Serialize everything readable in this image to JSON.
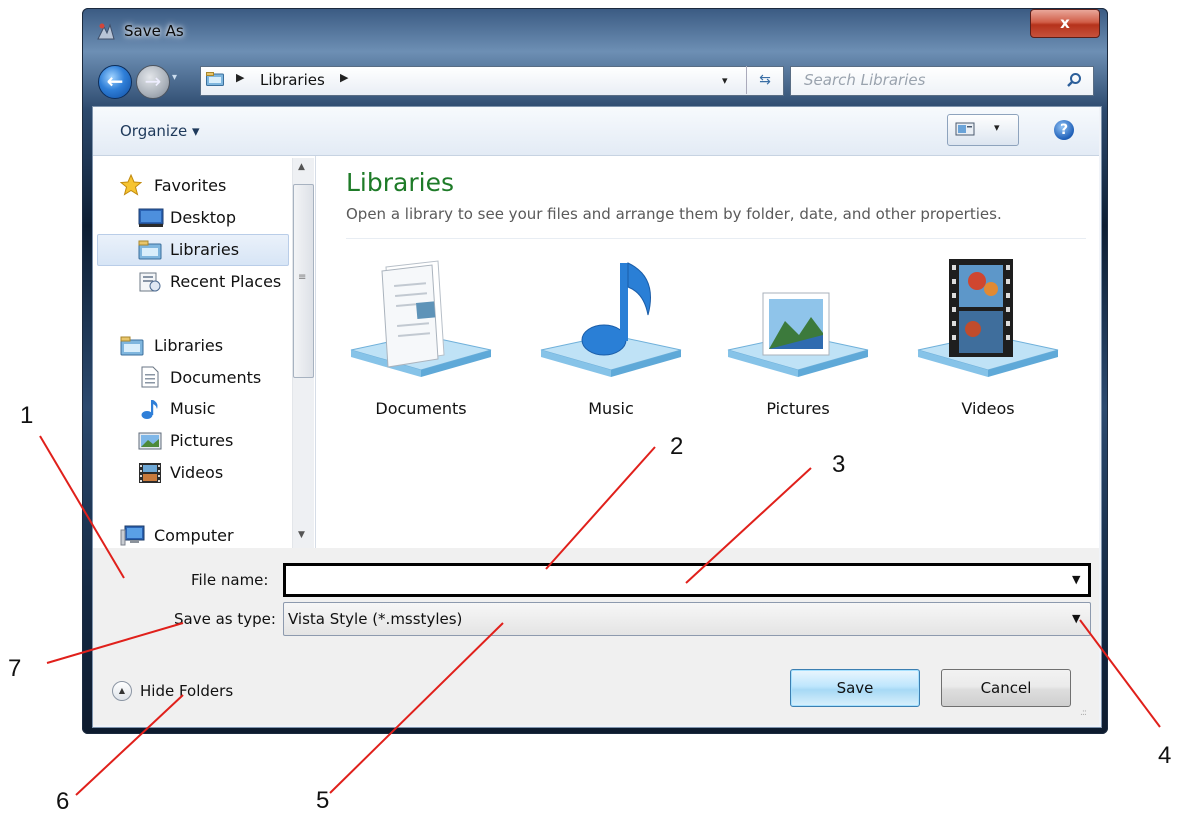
{
  "window": {
    "title": "Save As",
    "close_label": "x"
  },
  "nav": {
    "back_glyph": "←",
    "forward_glyph": "→",
    "dropdown_glyph": "▾",
    "address_separator": "▶",
    "address_text": "Libraries",
    "address_dropdown_glyph": "▾",
    "refresh_glyph": "⇆",
    "search_placeholder": "Search Libraries"
  },
  "toolbar": {
    "organize_label": "Organize ▾",
    "views_dropdown_glyph": "▾",
    "help_label": "?"
  },
  "sidebar": {
    "items": [
      {
        "label": "Favorites",
        "icon": "star-icon"
      },
      {
        "label": "Desktop",
        "icon": "desktop-icon"
      },
      {
        "label": "Libraries",
        "icon": "libraries-icon",
        "selected": true
      },
      {
        "label": "Recent Places",
        "icon": "recent-places-icon"
      },
      {
        "label": "Libraries",
        "icon": "libraries-icon"
      },
      {
        "label": "Documents",
        "icon": "documents-icon"
      },
      {
        "label": "Music",
        "icon": "music-icon"
      },
      {
        "label": "Pictures",
        "icon": "pictures-icon"
      },
      {
        "label": "Videos",
        "icon": "videos-icon"
      },
      {
        "label": "Computer",
        "icon": "computer-icon"
      }
    ],
    "scroll_up_glyph": "▲",
    "scroll_down_glyph": "▼",
    "scroll_grip_glyph": "≡"
  },
  "content": {
    "heading": "Libraries",
    "description": "Open a library to see your files and arrange them by folder, date, and other properties.",
    "libraries": [
      {
        "label": "Documents",
        "icon": "documents-library-icon"
      },
      {
        "label": "Music",
        "icon": "music-library-icon"
      },
      {
        "label": "Pictures",
        "icon": "pictures-library-icon"
      },
      {
        "label": "Videos",
        "icon": "videos-library-icon"
      }
    ]
  },
  "form": {
    "file_name_label": "File name:",
    "file_name_value": "",
    "save_as_type_label": "Save as type:",
    "save_as_type_value": "Vista Style (*.msstyles)",
    "dropdown_glyph": "▼",
    "hide_folders_label": "Hide Folders",
    "hide_folders_glyph": "▲",
    "save_label": "Save",
    "cancel_label": "Cancel",
    "resize_grip_glyph": ".::"
  },
  "callouts": [
    "1",
    "2",
    "3",
    "4",
    "5",
    "6",
    "7"
  ],
  "colors": {
    "heading_green": "#1e7b28",
    "callout_line_red": "#e0201b",
    "close_button_red": "#c7523c",
    "selection_blue": "#d7e5f6"
  }
}
